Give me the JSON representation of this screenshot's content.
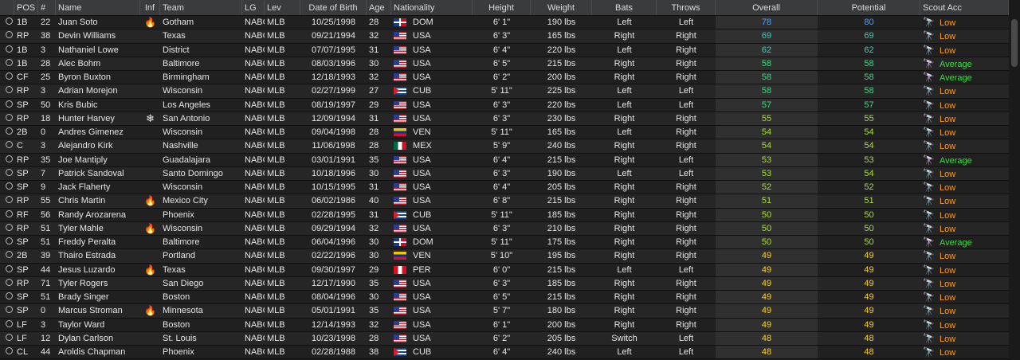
{
  "headers": [
    "",
    "POS",
    "#",
    "Name",
    "Inf",
    "Team",
    "LG",
    "Lev",
    "Date of Birth",
    "Age",
    "Nationality",
    "Height",
    "Weight",
    "Bats",
    "Throws",
    "Overall",
    "Potential",
    "Scout Acc"
  ],
  "colors": {
    "overall_blue": "#4aa3ff",
    "overall_teal": "#2fd3c8",
    "overall_green": "#36e07a",
    "overall_lime": "#a6e22e",
    "overall_yellow": "#ffd21f",
    "low": "#ff9c1a",
    "average": "#3ddc3d"
  },
  "players": [
    {
      "pos": "1B",
      "num": "22",
      "name": "Juan Soto",
      "inf": "fire",
      "team": "Gotham",
      "lg": "NABC",
      "lev": "MLB",
      "dob": "10/25/1998",
      "age": "28",
      "nat": "DOM",
      "height": "6' 1\"",
      "weight": "190 lbs",
      "bats": "Left",
      "throws": "Left",
      "overall": "78",
      "potential": "80",
      "tier": "blue",
      "scout": "Low"
    },
    {
      "pos": "RP",
      "num": "38",
      "name": "Devin Williams",
      "inf": "",
      "team": "Texas",
      "lg": "NABC",
      "lev": "MLB",
      "dob": "09/21/1994",
      "age": "32",
      "nat": "USA",
      "height": "6' 3\"",
      "weight": "165 lbs",
      "bats": "Right",
      "throws": "Right",
      "overall": "69",
      "potential": "69",
      "tier": "teal",
      "scout": "Low"
    },
    {
      "pos": "1B",
      "num": "3",
      "name": "Nathaniel Lowe",
      "inf": "",
      "team": "District",
      "lg": "NABC",
      "lev": "MLB",
      "dob": "07/07/1995",
      "age": "31",
      "nat": "USA",
      "height": "6' 4\"",
      "weight": "220 lbs",
      "bats": "Left",
      "throws": "Right",
      "overall": "62",
      "potential": "62",
      "tier": "teal",
      "scout": "Low"
    },
    {
      "pos": "1B",
      "num": "28",
      "name": "Alec Bohm",
      "inf": "",
      "team": "Baltimore",
      "lg": "NABC",
      "lev": "MLB",
      "dob": "08/03/1996",
      "age": "30",
      "nat": "USA",
      "height": "6' 5\"",
      "weight": "215 lbs",
      "bats": "Right",
      "throws": "Right",
      "overall": "58",
      "potential": "58",
      "tier": "green",
      "scout": "Average"
    },
    {
      "pos": "CF",
      "num": "25",
      "name": "Byron Buxton",
      "inf": "",
      "team": "Birmingham",
      "lg": "NABC",
      "lev": "MLB",
      "dob": "12/18/1993",
      "age": "32",
      "nat": "USA",
      "height": "6' 2\"",
      "weight": "200 lbs",
      "bats": "Right",
      "throws": "Right",
      "overall": "58",
      "potential": "58",
      "tier": "green",
      "scout": "Average"
    },
    {
      "pos": "RP",
      "num": "3",
      "name": "Adrian Morejon",
      "inf": "",
      "team": "Wisconsin",
      "lg": "NABC",
      "lev": "MLB",
      "dob": "02/27/1999",
      "age": "27",
      "nat": "CUB",
      "height": "5' 11\"",
      "weight": "225 lbs",
      "bats": "Left",
      "throws": "Left",
      "overall": "58",
      "potential": "58",
      "tier": "green",
      "scout": "Low"
    },
    {
      "pos": "SP",
      "num": "50",
      "name": "Kris Bubic",
      "inf": "",
      "team": "Los Angeles",
      "lg": "NABC",
      "lev": "MLB",
      "dob": "08/19/1997",
      "age": "29",
      "nat": "USA",
      "height": "6' 3\"",
      "weight": "220 lbs",
      "bats": "Left",
      "throws": "Left",
      "overall": "57",
      "potential": "57",
      "tier": "green",
      "scout": "Low"
    },
    {
      "pos": "RP",
      "num": "18",
      "name": "Hunter Harvey",
      "inf": "snow",
      "team": "San Antonio",
      "lg": "NABC",
      "lev": "MLB",
      "dob": "12/09/1994",
      "age": "31",
      "nat": "USA",
      "height": "6' 3\"",
      "weight": "230 lbs",
      "bats": "Right",
      "throws": "Right",
      "overall": "55",
      "potential": "55",
      "tier": "lime",
      "scout": "Low"
    },
    {
      "pos": "2B",
      "num": "0",
      "name": "Andres Gimenez",
      "inf": "",
      "team": "Wisconsin",
      "lg": "NABC",
      "lev": "MLB",
      "dob": "09/04/1998",
      "age": "28",
      "nat": "VEN",
      "height": "5' 11\"",
      "weight": "165 lbs",
      "bats": "Left",
      "throws": "Right",
      "overall": "54",
      "potential": "54",
      "tier": "lime",
      "scout": "Low"
    },
    {
      "pos": "C",
      "num": "3",
      "name": "Alejandro Kirk",
      "inf": "",
      "team": "Nashville",
      "lg": "NABC",
      "lev": "MLB",
      "dob": "11/06/1998",
      "age": "28",
      "nat": "MEX",
      "height": "5' 9\"",
      "weight": "240 lbs",
      "bats": "Right",
      "throws": "Right",
      "overall": "54",
      "potential": "54",
      "tier": "lime",
      "scout": "Low"
    },
    {
      "pos": "RP",
      "num": "35",
      "name": "Joe Mantiply",
      "inf": "",
      "team": "Guadalajara",
      "lg": "NABC",
      "lev": "MLB",
      "dob": "03/01/1991",
      "age": "35",
      "nat": "USA",
      "height": "6' 4\"",
      "weight": "215 lbs",
      "bats": "Right",
      "throws": "Left",
      "overall": "53",
      "potential": "53",
      "tier": "lime",
      "scout": "Average"
    },
    {
      "pos": "SP",
      "num": "7",
      "name": "Patrick Sandoval",
      "inf": "",
      "team": "Santo Domingo",
      "lg": "NABC",
      "lev": "MLB",
      "dob": "10/18/1996",
      "age": "30",
      "nat": "USA",
      "height": "6' 3\"",
      "weight": "190 lbs",
      "bats": "Left",
      "throws": "Left",
      "overall": "53",
      "potential": "54",
      "tier": "lime",
      "scout": "Low"
    },
    {
      "pos": "SP",
      "num": "9",
      "name": "Jack Flaherty",
      "inf": "",
      "team": "Wisconsin",
      "lg": "NABC",
      "lev": "MLB",
      "dob": "10/15/1995",
      "age": "31",
      "nat": "USA",
      "height": "6' 4\"",
      "weight": "205 lbs",
      "bats": "Right",
      "throws": "Right",
      "overall": "52",
      "potential": "52",
      "tier": "lime",
      "scout": "Low"
    },
    {
      "pos": "RP",
      "num": "55",
      "name": "Chris Martin",
      "inf": "fire",
      "team": "Mexico City",
      "lg": "NABC",
      "lev": "MLB",
      "dob": "06/02/1986",
      "age": "40",
      "nat": "USA",
      "height": "6' 8\"",
      "weight": "215 lbs",
      "bats": "Right",
      "throws": "Right",
      "overall": "51",
      "potential": "51",
      "tier": "lime",
      "scout": "Low"
    },
    {
      "pos": "RF",
      "num": "56",
      "name": "Randy Arozarena",
      "inf": "",
      "team": "Phoenix",
      "lg": "NABC",
      "lev": "MLB",
      "dob": "02/28/1995",
      "age": "31",
      "nat": "CUB",
      "height": "5' 11\"",
      "weight": "185 lbs",
      "bats": "Right",
      "throws": "Right",
      "overall": "50",
      "potential": "50",
      "tier": "lime",
      "scout": "Low"
    },
    {
      "pos": "RP",
      "num": "51",
      "name": "Tyler Mahle",
      "inf": "fire",
      "team": "Wisconsin",
      "lg": "NABC",
      "lev": "MLB",
      "dob": "09/29/1994",
      "age": "32",
      "nat": "USA",
      "height": "6' 3\"",
      "weight": "210 lbs",
      "bats": "Right",
      "throws": "Right",
      "overall": "50",
      "potential": "50",
      "tier": "lime",
      "scout": "Low"
    },
    {
      "pos": "SP",
      "num": "51",
      "name": "Freddy Peralta",
      "inf": "",
      "team": "Baltimore",
      "lg": "NABC",
      "lev": "MLB",
      "dob": "06/04/1996",
      "age": "30",
      "nat": "DOM",
      "height": "5' 11\"",
      "weight": "175 lbs",
      "bats": "Right",
      "throws": "Right",
      "overall": "50",
      "potential": "50",
      "tier": "lime",
      "scout": "Average"
    },
    {
      "pos": "2B",
      "num": "39",
      "name": "Thairo Estrada",
      "inf": "",
      "team": "Portland",
      "lg": "NABC",
      "lev": "MLB",
      "dob": "02/22/1996",
      "age": "30",
      "nat": "VEN",
      "height": "5' 10\"",
      "weight": "195 lbs",
      "bats": "Right",
      "throws": "Right",
      "overall": "49",
      "potential": "49",
      "tier": "yellow",
      "scout": "Low"
    },
    {
      "pos": "SP",
      "num": "44",
      "name": "Jesus Luzardo",
      "inf": "fire",
      "team": "Texas",
      "lg": "NABC",
      "lev": "MLB",
      "dob": "09/30/1997",
      "age": "29",
      "nat": "PER",
      "height": "6' 0\"",
      "weight": "215 lbs",
      "bats": "Left",
      "throws": "Left",
      "overall": "49",
      "potential": "49",
      "tier": "yellow",
      "scout": "Low"
    },
    {
      "pos": "RP",
      "num": "71",
      "name": "Tyler Rogers",
      "inf": "",
      "team": "San Diego",
      "lg": "NABC",
      "lev": "MLB",
      "dob": "12/17/1990",
      "age": "35",
      "nat": "USA",
      "height": "6' 3\"",
      "weight": "185 lbs",
      "bats": "Right",
      "throws": "Right",
      "overall": "49",
      "potential": "49",
      "tier": "yellow",
      "scout": "Low"
    },
    {
      "pos": "SP",
      "num": "51",
      "name": "Brady Singer",
      "inf": "",
      "team": "Boston",
      "lg": "NABC",
      "lev": "MLB",
      "dob": "08/04/1996",
      "age": "30",
      "nat": "USA",
      "height": "6' 5\"",
      "weight": "215 lbs",
      "bats": "Right",
      "throws": "Right",
      "overall": "49",
      "potential": "49",
      "tier": "yellow",
      "scout": "Low"
    },
    {
      "pos": "SP",
      "num": "0",
      "name": "Marcus Stroman",
      "inf": "fire",
      "team": "Minnesota",
      "lg": "NABC",
      "lev": "MLB",
      "dob": "05/01/1991",
      "age": "35",
      "nat": "USA",
      "height": "5' 7\"",
      "weight": "180 lbs",
      "bats": "Right",
      "throws": "Right",
      "overall": "49",
      "potential": "49",
      "tier": "yellow",
      "scout": "Low"
    },
    {
      "pos": "LF",
      "num": "3",
      "name": "Taylor Ward",
      "inf": "",
      "team": "Boston",
      "lg": "NABC",
      "lev": "MLB",
      "dob": "12/14/1993",
      "age": "32",
      "nat": "USA",
      "height": "6' 1\"",
      "weight": "200 lbs",
      "bats": "Right",
      "throws": "Right",
      "overall": "49",
      "potential": "49",
      "tier": "yellow",
      "scout": "Low"
    },
    {
      "pos": "LF",
      "num": "12",
      "name": "Dylan Carlson",
      "inf": "",
      "team": "St. Louis",
      "lg": "NABC",
      "lev": "MLB",
      "dob": "10/23/1998",
      "age": "28",
      "nat": "USA",
      "height": "6' 2\"",
      "weight": "205 lbs",
      "bats": "Switch",
      "throws": "Left",
      "overall": "48",
      "potential": "48",
      "tier": "yellow",
      "scout": "Low"
    },
    {
      "pos": "CL",
      "num": "44",
      "name": "Aroldis Chapman",
      "inf": "",
      "team": "Phoenix",
      "lg": "NABC",
      "lev": "MLB",
      "dob": "02/28/1988",
      "age": "38",
      "nat": "CUB",
      "height": "6' 4\"",
      "weight": "240 lbs",
      "bats": "Left",
      "throws": "Left",
      "overall": "48",
      "potential": "48",
      "tier": "yellow",
      "scout": "Low"
    }
  ]
}
